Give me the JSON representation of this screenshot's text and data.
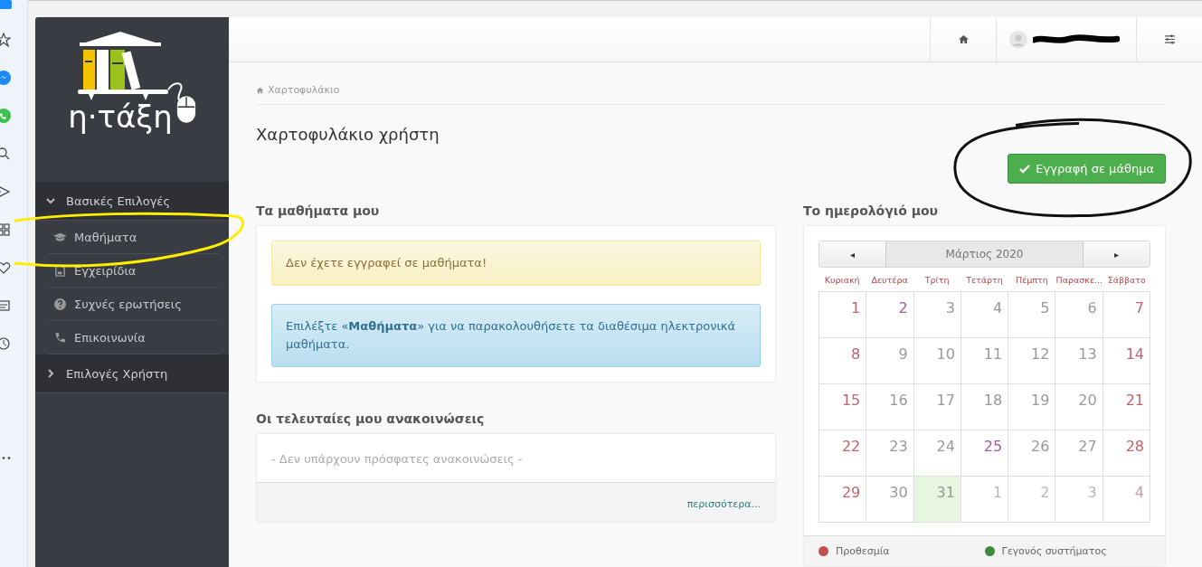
{
  "brand": {
    "name": "η·τάξη"
  },
  "sidebar": {
    "sections": [
      {
        "label": "Βασικές Επιλογές",
        "expanded": true,
        "items": [
          {
            "label": "Μαθήματα",
            "kind": "cap"
          },
          {
            "label": "Εγχειρίδια",
            "kind": "doc"
          },
          {
            "label": "Συχνές ερωτήσεις",
            "kind": "question"
          },
          {
            "label": "Επικοινωνία",
            "kind": "phone"
          }
        ]
      },
      {
        "label": "Επιλογές Χρήστη",
        "expanded": false
      }
    ]
  },
  "breadcrumb": "Χαρτοφυλάκιο",
  "page_title": "Χαρτοφυλάκιο χρήστη",
  "enroll_button": "Εγγραφή σε μάθημα",
  "courses": {
    "title": "Τα μαθήματα μου",
    "alerts": [
      {
        "kind": "warning",
        "text": "Δεν έχετε εγγραφεί σε μαθήματα!"
      },
      {
        "kind": "info",
        "text": "Επιλέξτε «**Μαθήματα**» για να παρακολουθήσετε τα διαθέσιμα ηλεκτρονικά μαθήματα."
      }
    ]
  },
  "announcements": {
    "title": "Οι τελευταίες μου ανακοινώσεις",
    "empty": "- Δεν υπάρχουν πρόσφατες ανακοινώσεις -",
    "more": "περισσότερα..."
  },
  "calendar": {
    "title": "Το ημερολόγιό μου",
    "prev": "◂",
    "next": "▸",
    "month": "Μάρτιος 2020",
    "weekdays": [
      "Κυριακή",
      "Δευτέρα",
      "Τρίτη",
      "Τετάρτη",
      "Πέμπτη",
      "Παρασκε...",
      "Σάββατο"
    ],
    "weeks": [
      [
        {
          "day": "1",
          "highlighted": false,
          "today": false,
          "other_month": false
        },
        {
          "day": "2",
          "highlighted": true,
          "today": false,
          "other_month": false
        },
        {
          "day": "3",
          "highlighted": false,
          "today": false,
          "other_month": false
        },
        {
          "day": "4",
          "highlighted": false,
          "today": false,
          "other_month": false
        },
        {
          "day": "5",
          "highlighted": false,
          "today": false,
          "other_month": false
        },
        {
          "day": "6",
          "highlighted": false,
          "today": false,
          "other_month": false
        },
        {
          "day": "7",
          "highlighted": false,
          "today": false,
          "other_month": false
        }
      ],
      [
        {
          "day": "8",
          "highlighted": false,
          "today": false,
          "other_month": false
        },
        {
          "day": "9",
          "highlighted": false,
          "today": false,
          "other_month": false
        },
        {
          "day": "10",
          "highlighted": false,
          "today": false,
          "other_month": false
        },
        {
          "day": "11",
          "highlighted": false,
          "today": false,
          "other_month": false
        },
        {
          "day": "12",
          "highlighted": false,
          "today": false,
          "other_month": false
        },
        {
          "day": "13",
          "highlighted": false,
          "today": false,
          "other_month": false
        },
        {
          "day": "14",
          "highlighted": false,
          "today": false,
          "other_month": false
        }
      ],
      [
        {
          "day": "15",
          "highlighted": false,
          "today": false,
          "other_month": false
        },
        {
          "day": "16",
          "highlighted": false,
          "today": false,
          "other_month": false
        },
        {
          "day": "17",
          "highlighted": false,
          "today": false,
          "other_month": false
        },
        {
          "day": "18",
          "highlighted": false,
          "today": false,
          "other_month": false
        },
        {
          "day": "19",
          "highlighted": false,
          "today": false,
          "other_month": false
        },
        {
          "day": "20",
          "highlighted": false,
          "today": false,
          "other_month": false
        },
        {
          "day": "21",
          "highlighted": false,
          "today": false,
          "other_month": false
        }
      ],
      [
        {
          "day": "22",
          "highlighted": false,
          "today": false,
          "other_month": false
        },
        {
          "day": "23",
          "highlighted": false,
          "today": false,
          "other_month": false
        },
        {
          "day": "24",
          "highlighted": false,
          "today": false,
          "other_month": false
        },
        {
          "day": "25",
          "highlighted": true,
          "today": false,
          "other_month": false
        },
        {
          "day": "26",
          "highlighted": false,
          "today": false,
          "other_month": false
        },
        {
          "day": "27",
          "highlighted": false,
          "today": false,
          "other_month": false
        },
        {
          "day": "28",
          "highlighted": false,
          "today": false,
          "other_month": false
        }
      ],
      [
        {
          "day": "29",
          "highlighted": false,
          "today": false,
          "other_month": false
        },
        {
          "day": "30",
          "highlighted": false,
          "today": false,
          "other_month": false
        },
        {
          "day": "31",
          "highlighted": false,
          "today": true,
          "other_month": false
        },
        {
          "day": "1",
          "highlighted": false,
          "today": false,
          "other_month": true
        },
        {
          "day": "2",
          "highlighted": false,
          "today": false,
          "other_month": true
        },
        {
          "day": "3",
          "highlighted": false,
          "today": false,
          "other_month": true
        },
        {
          "day": "4",
          "highlighted": false,
          "today": false,
          "other_month": true
        }
      ]
    ],
    "legend": [
      {
        "label": "Προθεσμία",
        "color": "#c0504d"
      },
      {
        "label": "Γεγονός συστήματος",
        "color": "#3d8b40"
      }
    ]
  }
}
